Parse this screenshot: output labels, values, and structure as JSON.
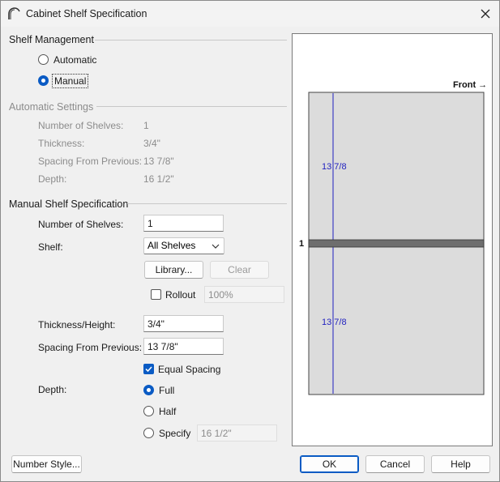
{
  "window": {
    "title": "Cabinet Shelf Specification"
  },
  "shelf_management": {
    "heading": "Shelf Management",
    "options": {
      "automatic": "Automatic",
      "manual": "Manual"
    },
    "selected": "manual"
  },
  "automatic_settings": {
    "heading": "Automatic Settings",
    "rows": {
      "number": {
        "label": "Number of Shelves:",
        "value": "1"
      },
      "thickness": {
        "label": "Thickness:",
        "value": "3/4\""
      },
      "spacing": {
        "label": "Spacing From Previous:",
        "value": "13 7/8\""
      },
      "depth": {
        "label": "Depth:",
        "value": "16 1/2\""
      }
    }
  },
  "manual_spec": {
    "heading": "Manual Shelf Specification",
    "number_label": "Number of Shelves:",
    "number_value": "1",
    "shelf_label": "Shelf:",
    "shelf_value": "All Shelves",
    "library_label": "Library...",
    "clear_label": "Clear",
    "rollout_label": "Rollout",
    "rollout_value": "100%",
    "thickness_label": "Thickness/Height:",
    "thickness_value": "3/4\"",
    "spacing_label": "Spacing From Previous:",
    "spacing_value": "13 7/8\"",
    "equal_spacing_label": "Equal Spacing",
    "equal_spacing_checked": true,
    "depth_label": "Depth:",
    "depth_options": {
      "full": "Full",
      "half": "Half",
      "specify": "Specify"
    },
    "depth_selected": "full",
    "specify_value": "16 1/2\""
  },
  "preview": {
    "front_label": "Front →",
    "top_spacing": "13 7/8",
    "bottom_spacing": "13 7/8",
    "shelf_number": "1",
    "dimension_color": "#1f1fbf",
    "shelf_color": "#6e6e6e",
    "cabinet_color": "#dcdcdc"
  },
  "footer": {
    "number_style_label": "Number Style...",
    "ok_label": "OK",
    "cancel_label": "Cancel",
    "help_label": "Help"
  }
}
